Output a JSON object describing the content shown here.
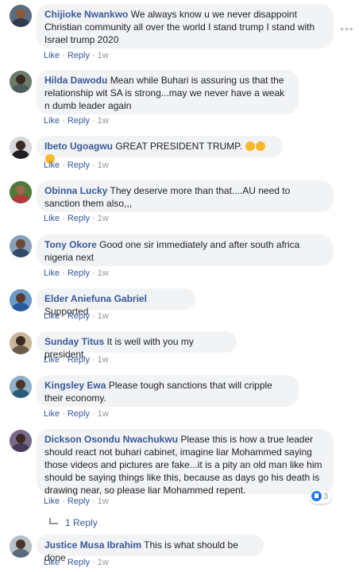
{
  "comments": [
    {
      "author": "Chijioke Nwankwo",
      "text": "We always know u we never disappoint Christian community all over the world I stand trump I stand with Israel trump 2020",
      "like_label": "Like",
      "reply_label": "Reply",
      "time": "1w",
      "avatar_colors": [
        "#5b6b7f",
        "#8a5a3c",
        "#2f3a4a"
      ]
    },
    {
      "author": "Hilda Dawodu",
      "text": "Mean while Buhari is assuring us that the relationship wit SA is strong...may we never have a weak n dumb leader again",
      "like_label": "Like",
      "reply_label": "Reply",
      "time": "1w",
      "avatar_colors": [
        "#6d7b6a",
        "#3b2a22",
        "#4c5c5a"
      ]
    },
    {
      "author": "Ibeto Ugoagwu",
      "text": "GREAT PRESIDENT TRUMP.",
      "like_label": "Like",
      "reply_label": "Reply",
      "time": "1w",
      "avatar_colors": [
        "#d6d8dc",
        "#3a2a20",
        "#1e1e22"
      ]
    },
    {
      "author": "Obinna Lucky",
      "text": "They deserve more than that....AU need to sanction them also,,,",
      "like_label": "Like",
      "reply_label": "Reply",
      "time": "1w",
      "avatar_colors": [
        "#4f7a3a",
        "#9a6a4a",
        "#b33a3a"
      ]
    },
    {
      "author": "Tony Okore",
      "text": "Good one sir immediately and after south africa nigeria next",
      "like_label": "Like",
      "reply_label": "Reply",
      "time": "1w",
      "avatar_colors": [
        "#8aa0b8",
        "#6b4a38",
        "#344a6a"
      ]
    },
    {
      "author": "Elder Aniefuna Gabriel",
      "text": "Supported",
      "like_label": "Like",
      "reply_label": "Reply",
      "time": "1w",
      "avatar_colors": [
        "#6a9ac8",
        "#5a3a2a",
        "#2a5a9a"
      ]
    },
    {
      "author": "Sunday Titus",
      "text": "It is well with you my president",
      "like_label": "Like",
      "reply_label": "Reply",
      "time": "1w",
      "avatar_colors": [
        "#c8b89a",
        "#3a2a22",
        "#6a5a4a"
      ]
    },
    {
      "author": "Kingsley Ewa",
      "text": "Please tough sanctions that will cripple their economy.",
      "like_label": "Like",
      "reply_label": "Reply",
      "time": "1w",
      "avatar_colors": [
        "#8fb0c8",
        "#4a3628",
        "#2a5a7a"
      ]
    },
    {
      "author": "Dickson Osondu Nwachukwu",
      "text": "Please this is how a true leader should react not buhari cabinet, imagine liar Mohammed saying those videos and pictures are fake...it is a pity an old man like him should be saying things like this, because as days go his death is drawing near, so please liar Mohammed repent.",
      "like_label": "Like",
      "reply_label": "Reply",
      "time": "1w",
      "avatar_colors": [
        "#7a6a8a",
        "#3a2a22",
        "#4a3a5a"
      ],
      "reaction_count": "3"
    },
    {
      "author": "Justice Musa Ibrahim",
      "text": "This is what should be done",
      "like_label": "Like",
      "reply_label": "Reply",
      "time": "1w",
      "avatar_colors": [
        "#b8c0c8",
        "#4a3628",
        "#5a6a7a"
      ]
    }
  ],
  "replies_link": "1 Reply",
  "more_icon": "ellipsis-icon",
  "colors": {
    "author": "#385898",
    "bubble": "#f2f3f5",
    "meta": "#90949c",
    "like_blue": "#2078f4"
  }
}
